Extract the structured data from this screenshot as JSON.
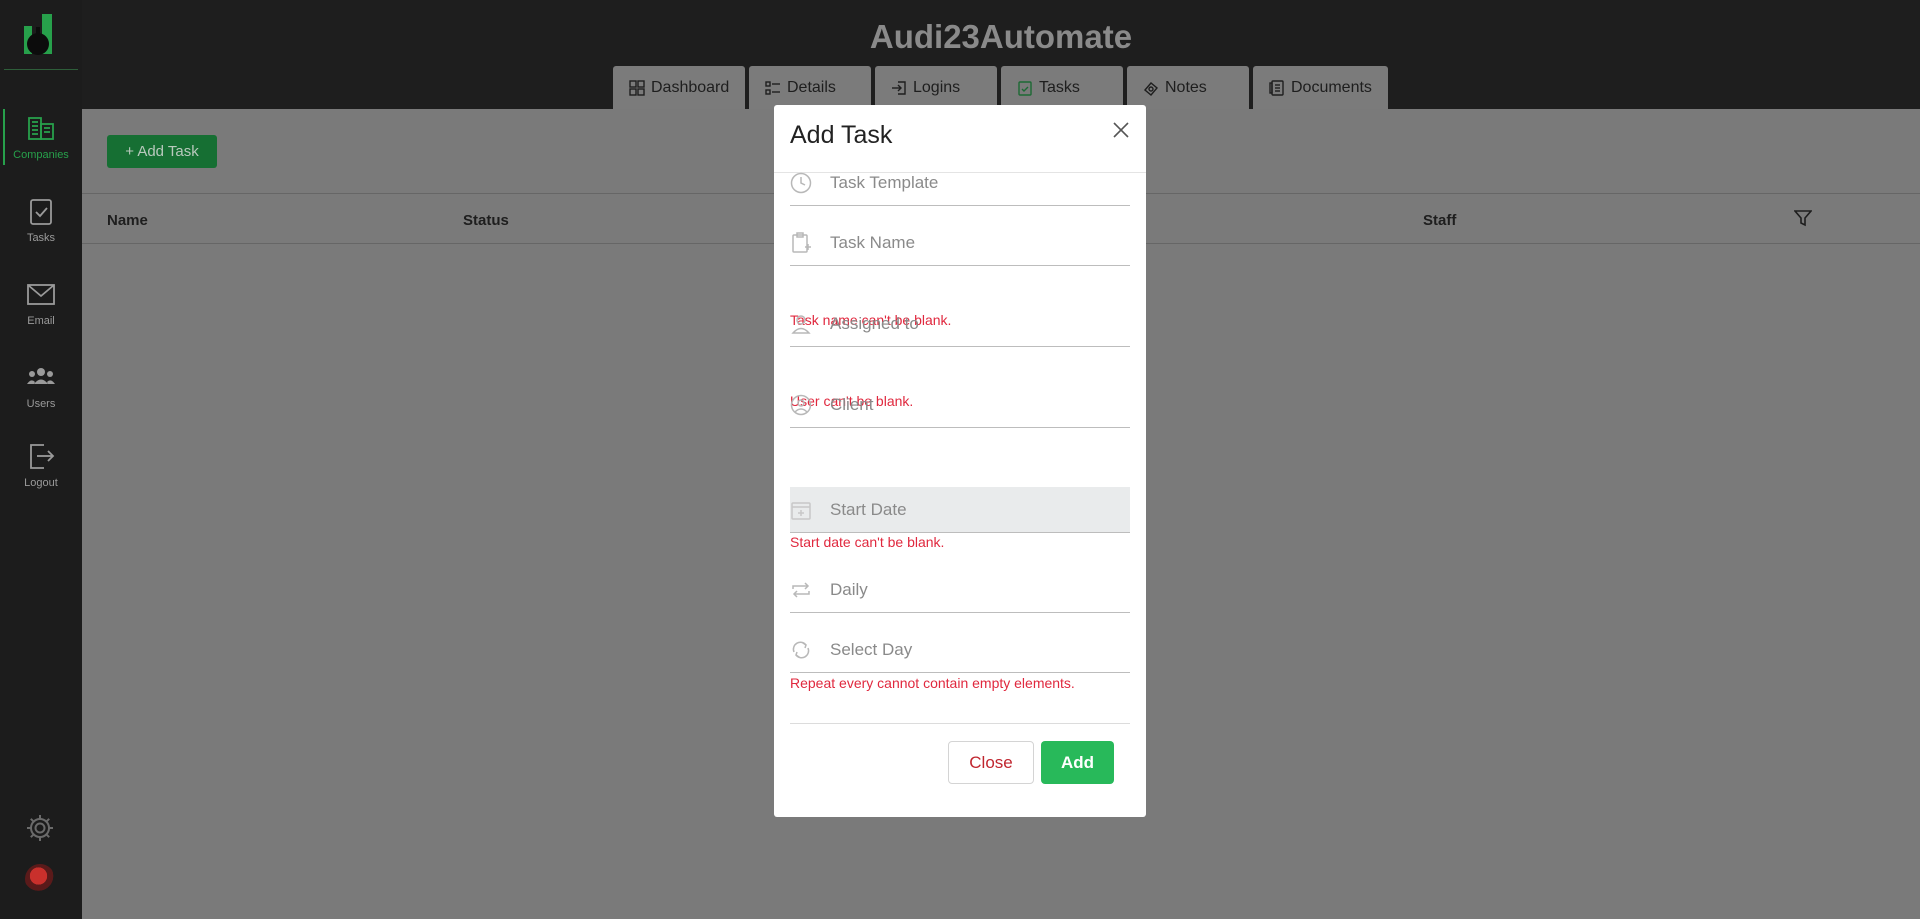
{
  "app": {
    "title": "Audi23Automate"
  },
  "sidebar": {
    "items": [
      {
        "label": "Companies",
        "icon": "building-grid-icon",
        "active": true
      },
      {
        "label": "Tasks",
        "icon": "clipboard-check-icon"
      },
      {
        "label": "Email",
        "icon": "envelope-icon"
      },
      {
        "label": "Users",
        "icon": "users-icon"
      },
      {
        "label": "Logout",
        "icon": "logout-icon"
      }
    ]
  },
  "tabs": [
    {
      "label": "Dashboard",
      "icon": "dashboard-icon"
    },
    {
      "label": "Details",
      "icon": "checklist-icon"
    },
    {
      "label": "Logins",
      "icon": "login-icon"
    },
    {
      "label": "Tasks",
      "icon": "clipboard-check-icon",
      "active": true
    },
    {
      "label": "Notes",
      "icon": "notes-icon"
    },
    {
      "label": "Documents",
      "icon": "documents-icon"
    }
  ],
  "main": {
    "add_task_label": "+ Add Task",
    "columns": [
      "Name",
      "Status",
      "Staff"
    ]
  },
  "modal": {
    "title": "Add Task",
    "fields": {
      "task_template": {
        "placeholder": "Task Template"
      },
      "task_name": {
        "placeholder": "Task Name",
        "error": "Task name can't be blank."
      },
      "assigned_to": {
        "placeholder": "Assigned to",
        "error": "User can't be blank."
      },
      "client": {
        "placeholder": "Client"
      },
      "start_date": {
        "placeholder": "Start Date",
        "error": "Start date can't be blank."
      },
      "repeat": {
        "placeholder": "Daily"
      },
      "select_day": {
        "placeholder": "Select Day",
        "error": "Repeat every cannot contain empty elements."
      }
    },
    "close_label": "Close",
    "add_label": "Add"
  },
  "colors": {
    "accent": "#28b95a",
    "error": "#e0283e",
    "sidebar_bg": "#1c1c1c",
    "overlay": "#7a7a7a"
  }
}
